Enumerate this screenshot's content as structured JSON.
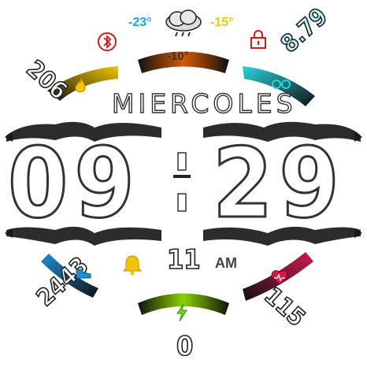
{
  "weather": {
    "temp_min": "-23°",
    "temp_max": "-15°",
    "temp_now": "-10°",
    "condition_icon": "cloud-rain-icon"
  },
  "status": {
    "bluetooth_icon": "bluetooth-icon",
    "lock_icon": "lock-icon"
  },
  "day_name": "MIERCOLES",
  "time": {
    "hour": "09",
    "minute": "29",
    "seconds": "11",
    "ampm": "AM"
  },
  "stats": {
    "calories": "206",
    "distance": "8.79",
    "steps": "2443",
    "heart_rate": "115",
    "alarm_icon": "bell-icon",
    "battery_value": "0",
    "battery_icon": "lightning-icon"
  },
  "colors": {
    "calories_arc": "#f2c500",
    "distance_arc": "#2bd3e0",
    "steps_arc": "#1e8fd6",
    "heart_arc": "#d11a4f",
    "temp_arc": "#d65a00",
    "battery_arc": "#8bd100",
    "bluetooth": "#d11a1a",
    "lock": "#d11a1a",
    "temp_min": "#1ba3ff",
    "temp_max": "#f2c500",
    "bell": "#f2c500",
    "bolt": "#6fdc1a"
  }
}
